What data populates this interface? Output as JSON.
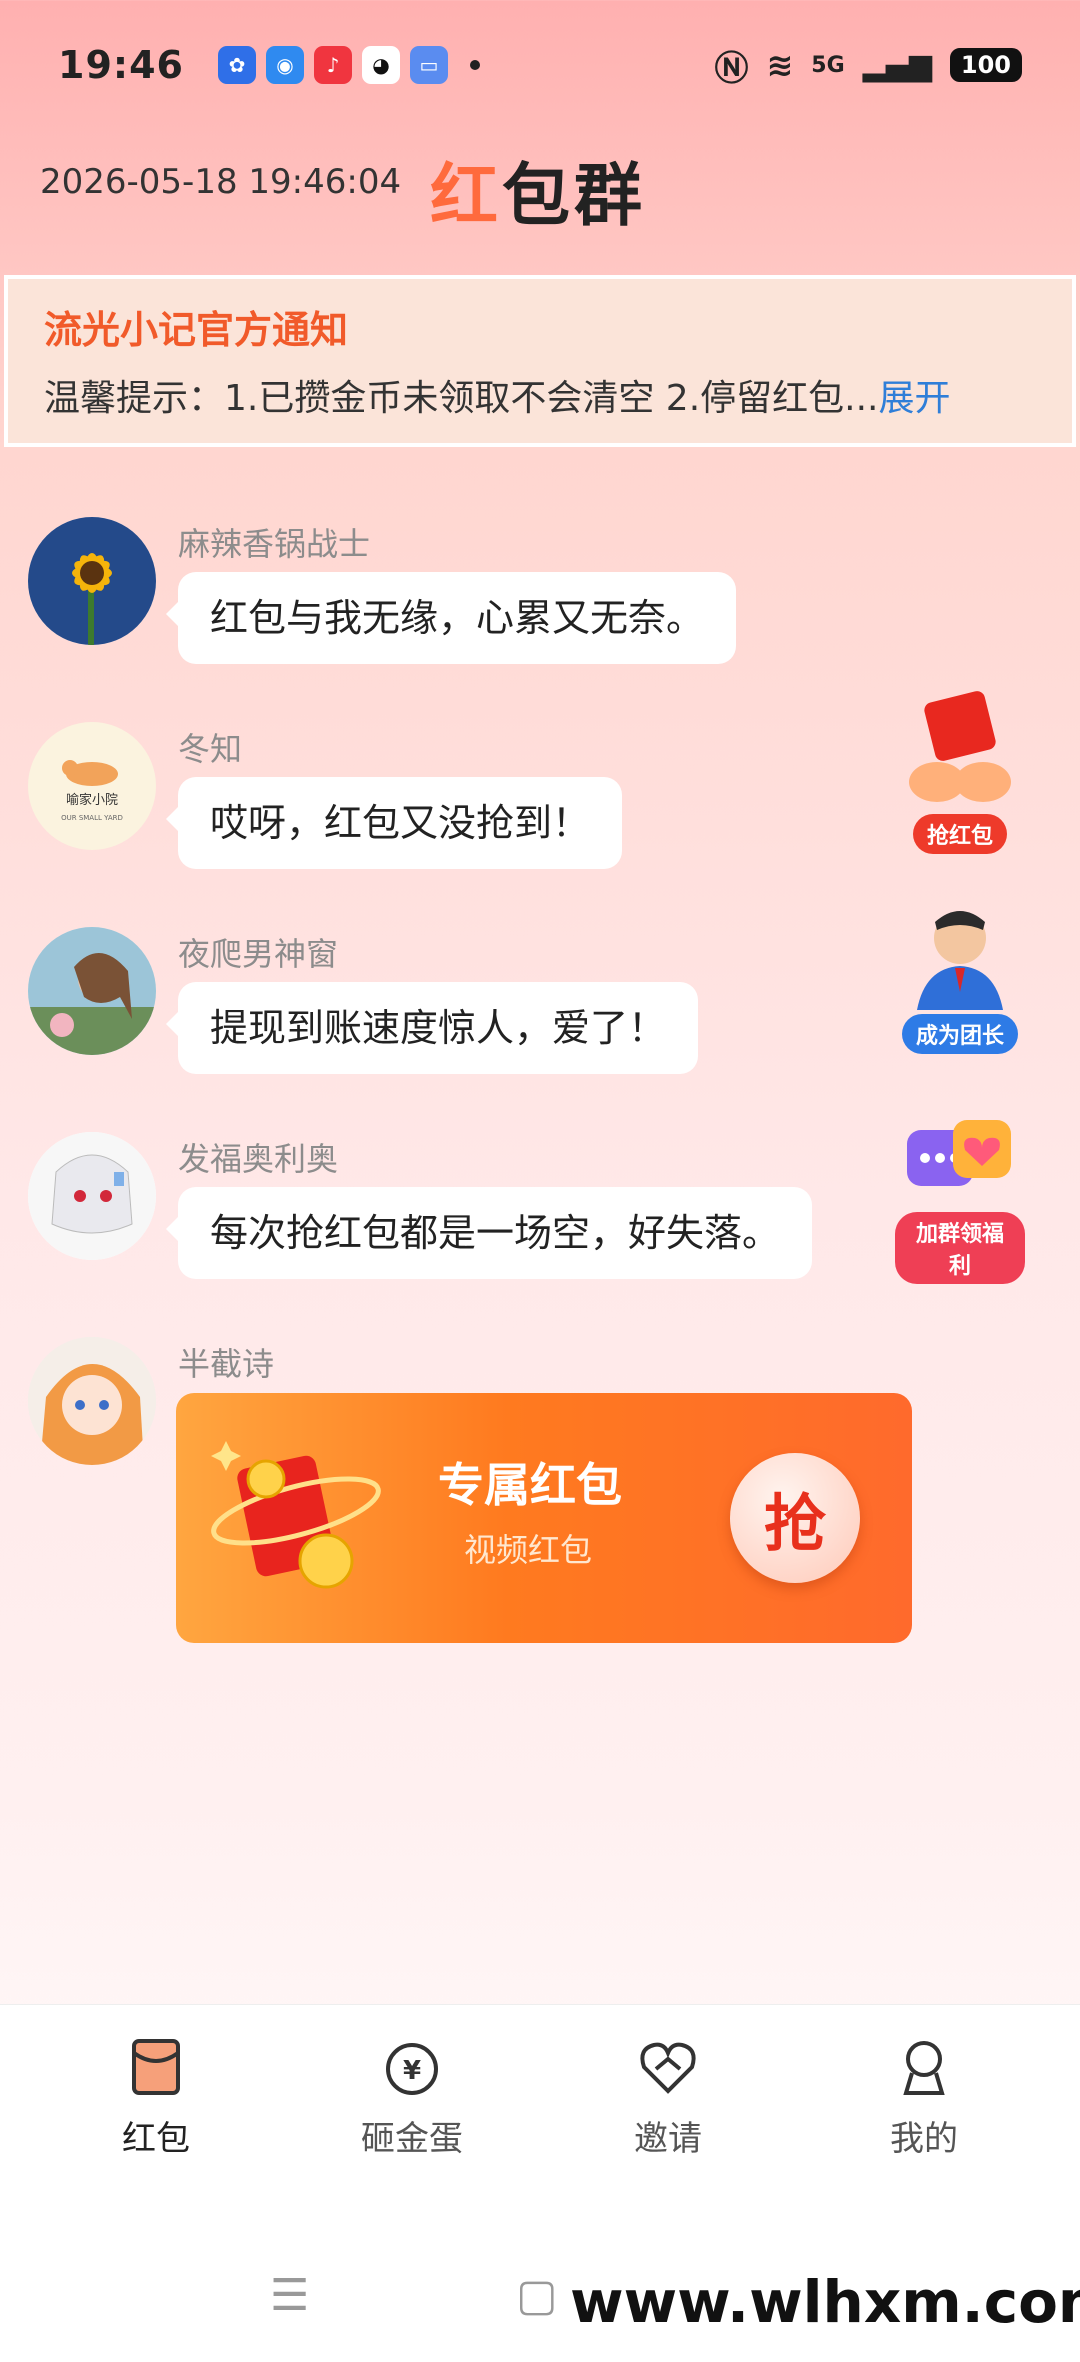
{
  "status_bar": {
    "time": "19:46",
    "network": "5G",
    "battery": "100"
  },
  "header": {
    "datetime": "2026-05-18 19:46:04",
    "title_first": "红",
    "title_rest": "包群"
  },
  "notice": {
    "title": "流光小记官方通知",
    "text": "温馨提示：1.已攒金币未领取不会清空 2.停留红包...",
    "expand": "展开"
  },
  "messages": [
    {
      "name": "麻辣香锅战士",
      "text": "红包与我无缘，心累又无奈。"
    },
    {
      "name": "冬知",
      "text": "哎呀，红包又没抢到！"
    },
    {
      "name": "夜爬男神窗",
      "text": "提现到账速度惊人，爱了！"
    },
    {
      "name": "发福奥利奥",
      "text": "每次抢红包都是一场空，好失落。"
    },
    {
      "name": "半截诗"
    }
  ],
  "red_packet": {
    "title": "专属红包",
    "subtitle": "视频红包",
    "grab": "抢"
  },
  "side_buttons": {
    "grab": "抢红包",
    "leader": "成为团长",
    "join": "加群领福利"
  },
  "avatar_text": {
    "dongzhi_line1": "喻家小院",
    "dongzhi_line2": "OUR SMALL YARD"
  },
  "nav": {
    "items": [
      {
        "label": "红包",
        "active": true
      },
      {
        "label": "砸金蛋"
      },
      {
        "label": "邀请"
      },
      {
        "label": "我的"
      }
    ]
  },
  "watermark": "www.wlhxm.com",
  "colors": {
    "accent": "#ff6a3d",
    "notice_title": "#f15a2a",
    "expand_link": "#2f7ed8"
  }
}
